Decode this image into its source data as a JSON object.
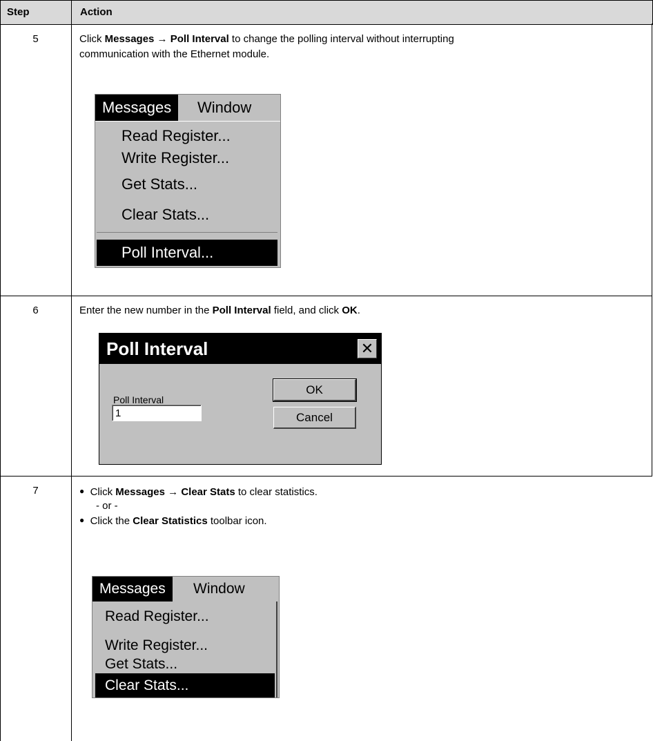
{
  "header": {
    "step": "Step",
    "action": "Action"
  },
  "rows": [
    {
      "step": "5",
      "text": {
        "pre": "Click ",
        "b1": "Messages",
        "arrow": " → ",
        "b2": "Poll Interval",
        "post1": " to change the polling interval without interrupting",
        "post2": "communication with the Ethernet module."
      },
      "menu": {
        "bar_messages": "Messages",
        "bar_window": "Window",
        "items": [
          "Read Register...",
          "Write Register...",
          "Get Stats...",
          "Clear Stats...",
          "Poll Interval..."
        ],
        "selected": "Poll Interval..."
      }
    },
    {
      "step": "6",
      "text": {
        "pre": "Enter the new number in the ",
        "b1": "Poll Interval",
        "mid": " field, and click ",
        "b2": "OK",
        "post": "."
      },
      "dialog": {
        "title": "Poll Interval",
        "close": "✕",
        "label": "Poll Interval",
        "value": "1",
        "ok": "OK",
        "cancel": "Cancel"
      }
    },
    {
      "step": "7",
      "bullet1": {
        "pre": "Click ",
        "b1": "Messages",
        "arrow": " → ",
        "b2": "Clear Stats",
        "post": " to clear statistics."
      },
      "or": "- or -",
      "bullet2": {
        "pre": "Click the ",
        "b1": "Clear Statistics",
        "post": " toolbar icon."
      },
      "menu": {
        "bar_messages": "Messages",
        "bar_window": "Window",
        "items": [
          "Read Register...",
          "Write Register...",
          "Get Stats...",
          "Clear Stats..."
        ],
        "selected": "Clear Stats..."
      }
    }
  ]
}
